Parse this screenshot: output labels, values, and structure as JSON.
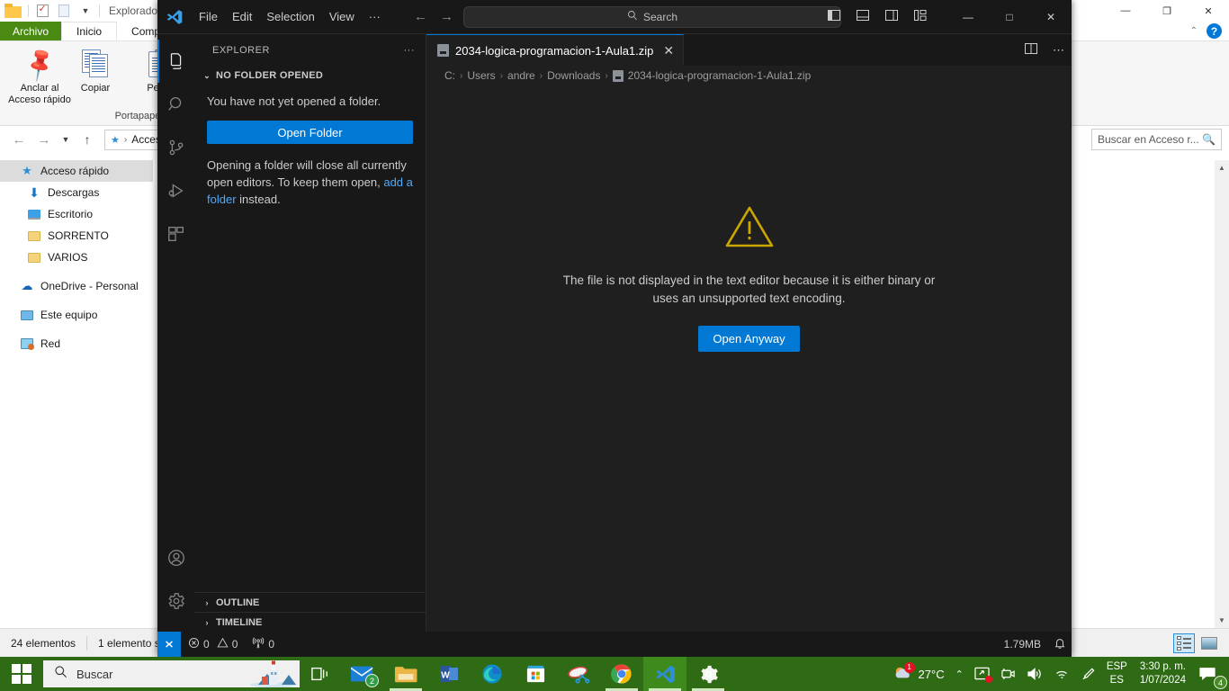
{
  "explorer_window": {
    "title": "Explorador de",
    "quick_access_toolbar": [
      "folder-icon",
      "properties-icon",
      "new-folder-icon",
      "customize-icon"
    ],
    "window_buttons": {
      "minimize": "—",
      "maximize": "❐",
      "close": "✕"
    },
    "ribbon_tabs": [
      {
        "label": "Archivo",
        "style": "file"
      },
      {
        "label": "Inicio",
        "style": "active"
      },
      {
        "label": "Compartir",
        "style": "normal"
      }
    ],
    "ribbon_buttons": [
      {
        "label": "Anclar al\nAcceso rápido",
        "line1": "Anclar al",
        "line2": "Acceso rápido",
        "icon": "pin-icon"
      },
      {
        "label": "Copiar",
        "icon": "copy-icon"
      },
      {
        "label": "Pegar",
        "icon": "paste-icon"
      }
    ],
    "ribbon_group_label": "Portapapeles",
    "address": {
      "value": "Acceso",
      "star_icon": "quick-access-star-icon"
    },
    "search": {
      "placeholder": "Buscar en Acceso r...",
      "icon": "search-icon"
    },
    "nav_items": [
      {
        "label": "Acceso rápido",
        "icon": "star-icon",
        "selected": true,
        "indent": false
      },
      {
        "label": "Descargas",
        "icon": "download-icon",
        "selected": false,
        "indent": true
      },
      {
        "label": "Escritorio",
        "icon": "desktop-icon",
        "selected": false,
        "indent": true
      },
      {
        "label": "SORRENTO",
        "icon": "folder-icon",
        "selected": false,
        "indent": true
      },
      {
        "label": "VARIOS",
        "icon": "folder-icon",
        "selected": false,
        "indent": true
      },
      {
        "label": "OneDrive - Personal",
        "icon": "cloud-icon",
        "selected": false,
        "indent": false
      },
      {
        "label": "Este equipo",
        "icon": "pc-icon",
        "selected": false,
        "indent": false
      },
      {
        "label": "Red",
        "icon": "network-icon",
        "selected": false,
        "indent": false
      }
    ],
    "status": {
      "items_count": "24 elementos",
      "selected_count": "1 elemento s"
    },
    "view_buttons": [
      {
        "name": "details-view",
        "active": true
      },
      {
        "name": "large-icons-view",
        "active": false
      }
    ],
    "help_icon": "?"
  },
  "vscode": {
    "menu": [
      "File",
      "Edit",
      "Selection",
      "View",
      "···"
    ],
    "nav": {
      "back": "←",
      "forward": "→"
    },
    "search": {
      "placeholder": "Search",
      "icon": "search-icon"
    },
    "layout_icons": [
      "toggle-primary-sidebar-icon",
      "toggle-panel-icon",
      "toggle-secondary-sidebar-icon",
      "customize-layout-icon"
    ],
    "window_buttons": {
      "minimize": "—",
      "maximize": "□",
      "close": "✕"
    },
    "activity_bar": [
      {
        "name": "explorer",
        "icon": "files-icon",
        "active": true
      },
      {
        "name": "search",
        "icon": "search-icon",
        "active": false
      },
      {
        "name": "source-control",
        "icon": "source-control-icon",
        "active": false
      },
      {
        "name": "run-and-debug",
        "icon": "debug-icon",
        "active": false
      },
      {
        "name": "extensions",
        "icon": "extensions-icon",
        "active": false
      },
      {
        "name": "accounts",
        "icon": "account-icon",
        "active": false
      },
      {
        "name": "manage",
        "icon": "gear-icon",
        "active": false
      }
    ],
    "sidebar": {
      "title": "EXPLORER",
      "more_actions": "···",
      "section_title": "NO FOLDER OPENED",
      "message": "You have not yet opened a folder.",
      "open_folder_button": "Open Folder",
      "hint_pre": "Opening a folder will close all currently open editors. To keep them open, ",
      "hint_link": "add a folder",
      "hint_post": " instead.",
      "bottom_sections": [
        "OUTLINE",
        "TIMELINE"
      ]
    },
    "editor": {
      "tab": {
        "label": "2034-logica-programacion-1-Aula1.zip",
        "icon": "binary-file-icon",
        "close": "✕"
      },
      "tab_actions": [
        "split-editor-icon",
        "more-actions-icon"
      ],
      "breadcrumb": [
        "C:",
        "Users",
        "andre",
        "Downloads",
        "2034-logica-programacion-1-Aula1.zip"
      ],
      "warning_icon": "warning-triangle-icon",
      "message": "The file is not displayed in the text editor because it is either binary or uses an unsupported text encoding.",
      "open_anyway_button": "Open Anyway"
    },
    "status_bar": {
      "remote_icon": "remote-window-icon",
      "errors": "0",
      "warnings": "0",
      "ports": "0",
      "file_size": "1.79MB",
      "bell_icon": "notifications-bell-icon"
    },
    "colors": {
      "accent": "#0078d4",
      "warning": "#cca700",
      "link": "#4daafc"
    }
  },
  "taskbar": {
    "start": "windows-start-icon",
    "search": {
      "placeholder": "Buscar",
      "icon": "search-icon"
    },
    "task_view": "task-view-icon",
    "apps": [
      {
        "name": "mail",
        "badge": "2",
        "running": false
      },
      {
        "name": "file-explorer",
        "running": true
      },
      {
        "name": "word",
        "running": false
      },
      {
        "name": "edge",
        "running": false
      },
      {
        "name": "microsoft-store",
        "running": false
      },
      {
        "name": "snipping-tool",
        "running": false
      },
      {
        "name": "chrome",
        "running": true
      },
      {
        "name": "vscode",
        "running": true,
        "active": true
      },
      {
        "name": "settings",
        "running": true
      }
    ],
    "tray": {
      "weather_temp": "27°C",
      "weather_badge": "1",
      "chevron": "^",
      "icons": [
        "screen-share-icon",
        "camera-icon",
        "volume-icon",
        "wifi-icon",
        "pen-icon"
      ],
      "language_line1": "ESP",
      "language_line2": "ES",
      "time": "3:30 p. m.",
      "date": "1/07/2024",
      "notifications_badge": "4"
    },
    "colors": {
      "background": "#2e6b14"
    }
  }
}
